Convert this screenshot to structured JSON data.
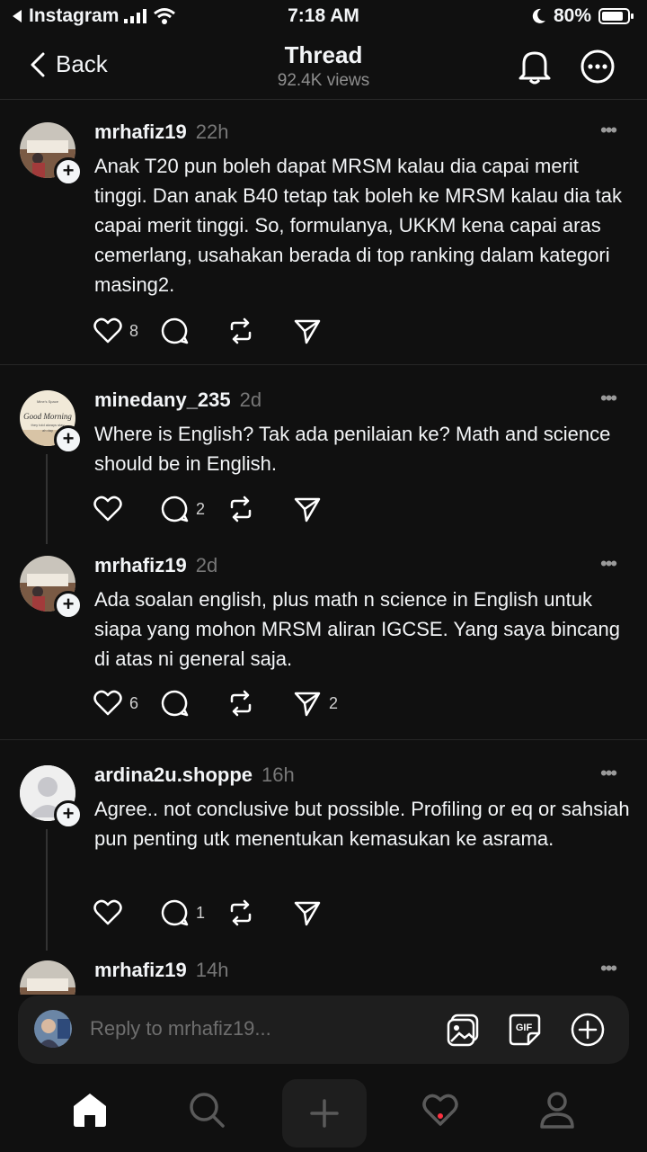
{
  "status_bar": {
    "back_app": "Instagram",
    "time": "7:18 AM",
    "battery": "80%"
  },
  "header": {
    "back_label": "Back",
    "title": "Thread",
    "views": "92.4K views"
  },
  "posts": [
    {
      "username": "mrhafiz19",
      "time": "22h",
      "text": "Anak T20 pun boleh dapat MRSM kalau dia capai merit tinggi. Dan anak B40 tetap tak boleh ke MRSM kalau dia tak capai merit tinggi. So, formulanya, UKKM kena capai aras cemerlang, usahakan berada di top ranking dalam kategori masing2.",
      "likes": "8",
      "replies": "",
      "reposts": "",
      "shares": ""
    },
    {
      "username": "minedany_235",
      "time": "2d",
      "text": "Where is English? Tak ada penilaian ke? Math and science should be in English.",
      "likes": "",
      "replies": "2",
      "reposts": "",
      "shares": ""
    },
    {
      "username": "mrhafiz19",
      "time": "2d",
      "text": "Ada soalan english, plus math n science in English untuk siapa yang mohon MRSM aliran IGCSE. Yang saya bincang di atas ni general saja.",
      "likes": "6",
      "replies": "",
      "reposts": "",
      "shares": "2"
    },
    {
      "username": "ardina2u.shoppe",
      "time": "16h",
      "text": "Agree.. not conclusive but possible.  Profiling or eq or sahsiah pun penting utk menentukan kemasukan ke asrama.",
      "likes": "",
      "replies": "1",
      "reposts": "",
      "shares": ""
    },
    {
      "username": "mrhafiz19",
      "time": "14h",
      "text": "",
      "likes": "",
      "replies": "",
      "reposts": "",
      "shares": ""
    }
  ],
  "avatar_texts": {
    "good_morning": "Good Morning",
    "small_caption": "Mine's Space",
    "small_caption_lower": "they told always stay",
    "small_caption_last": "ah day"
  },
  "reply_bar": {
    "placeholder": "Reply to mrhafiz19...",
    "gif_label": "GIF"
  },
  "tabs": [
    "home-icon",
    "search-icon",
    "create-icon",
    "activity-icon",
    "profile-icon"
  ],
  "colors": {
    "background": "#101010",
    "text": "#f3f5f7",
    "muted": "#777777",
    "notification_dot": "#ff3040"
  }
}
